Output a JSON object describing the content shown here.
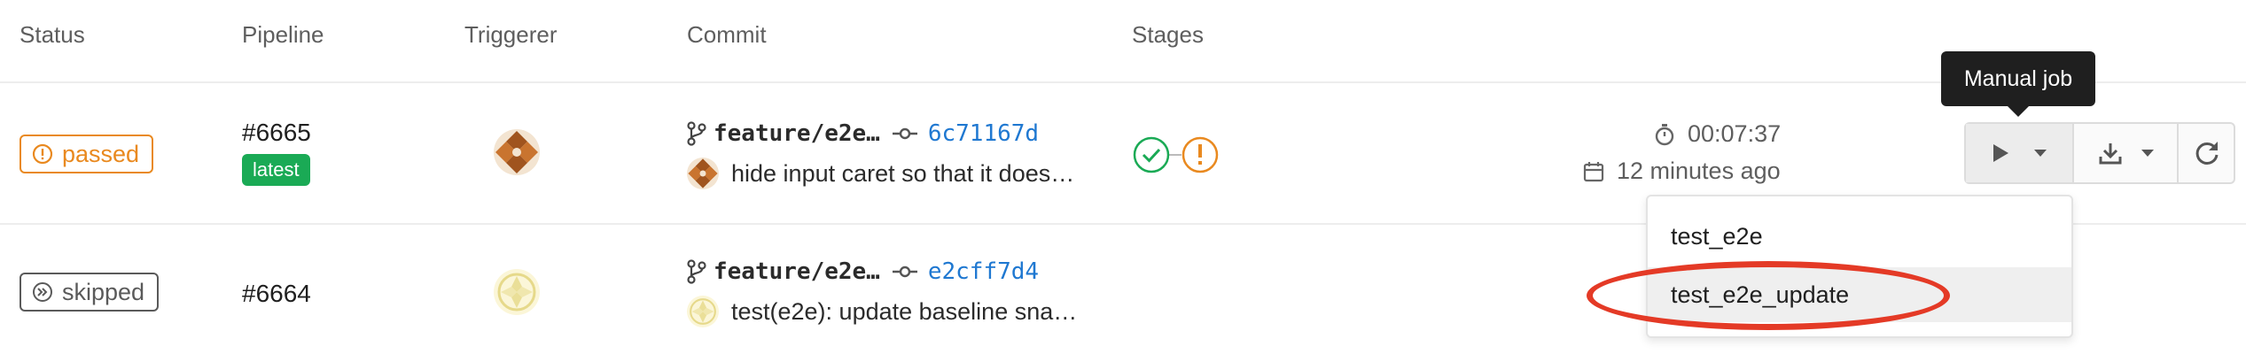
{
  "table": {
    "headers": [
      "Status",
      "Pipeline",
      "Triggerer",
      "Commit",
      "Stages"
    ]
  },
  "rows": [
    {
      "status": "passed",
      "pipeline_id": "#6665",
      "badge": "latest",
      "branch": "feature/e2e…",
      "sha": "6c71167d",
      "message": "hide input caret so that it does…",
      "duration": "00:07:37",
      "finished": "12 minutes ago"
    },
    {
      "status": "skipped",
      "pipeline_id": "#6664",
      "branch": "feature/e2e…",
      "sha": "e2cff7d4",
      "message": "test(e2e): update baseline sna…"
    }
  ],
  "actions": {
    "tooltip": "Manual job",
    "manual_jobs": [
      "test_e2e",
      "test_e2e_update"
    ]
  },
  "colors": {
    "passed": "#e9891f",
    "success": "#1aaa55",
    "skipped": "#5a5a5a",
    "link": "#1f78d1",
    "highlight": "#e43a26"
  }
}
